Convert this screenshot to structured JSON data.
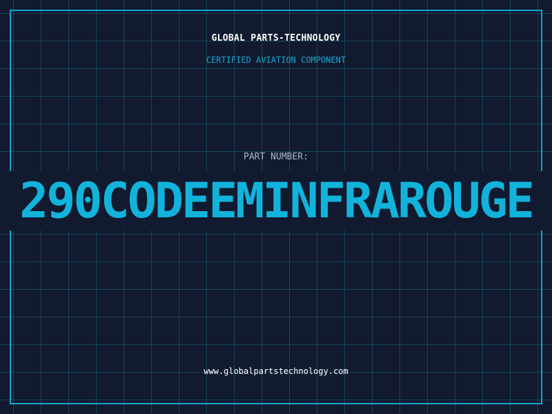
{
  "header": {
    "company": "GLOBAL PARTS-TECHNOLOGY",
    "tagline": "CERTIFIED AVIATION COMPONENT"
  },
  "part": {
    "label": "PART NUMBER:",
    "number": "290CODEEMINFRAROUGE"
  },
  "footer": {
    "website": "www.globalpartstechnology.com"
  },
  "colors": {
    "background": "#111a2e",
    "accent": "#12b3db",
    "grid": "#1c6682",
    "text": "#ffffff"
  }
}
